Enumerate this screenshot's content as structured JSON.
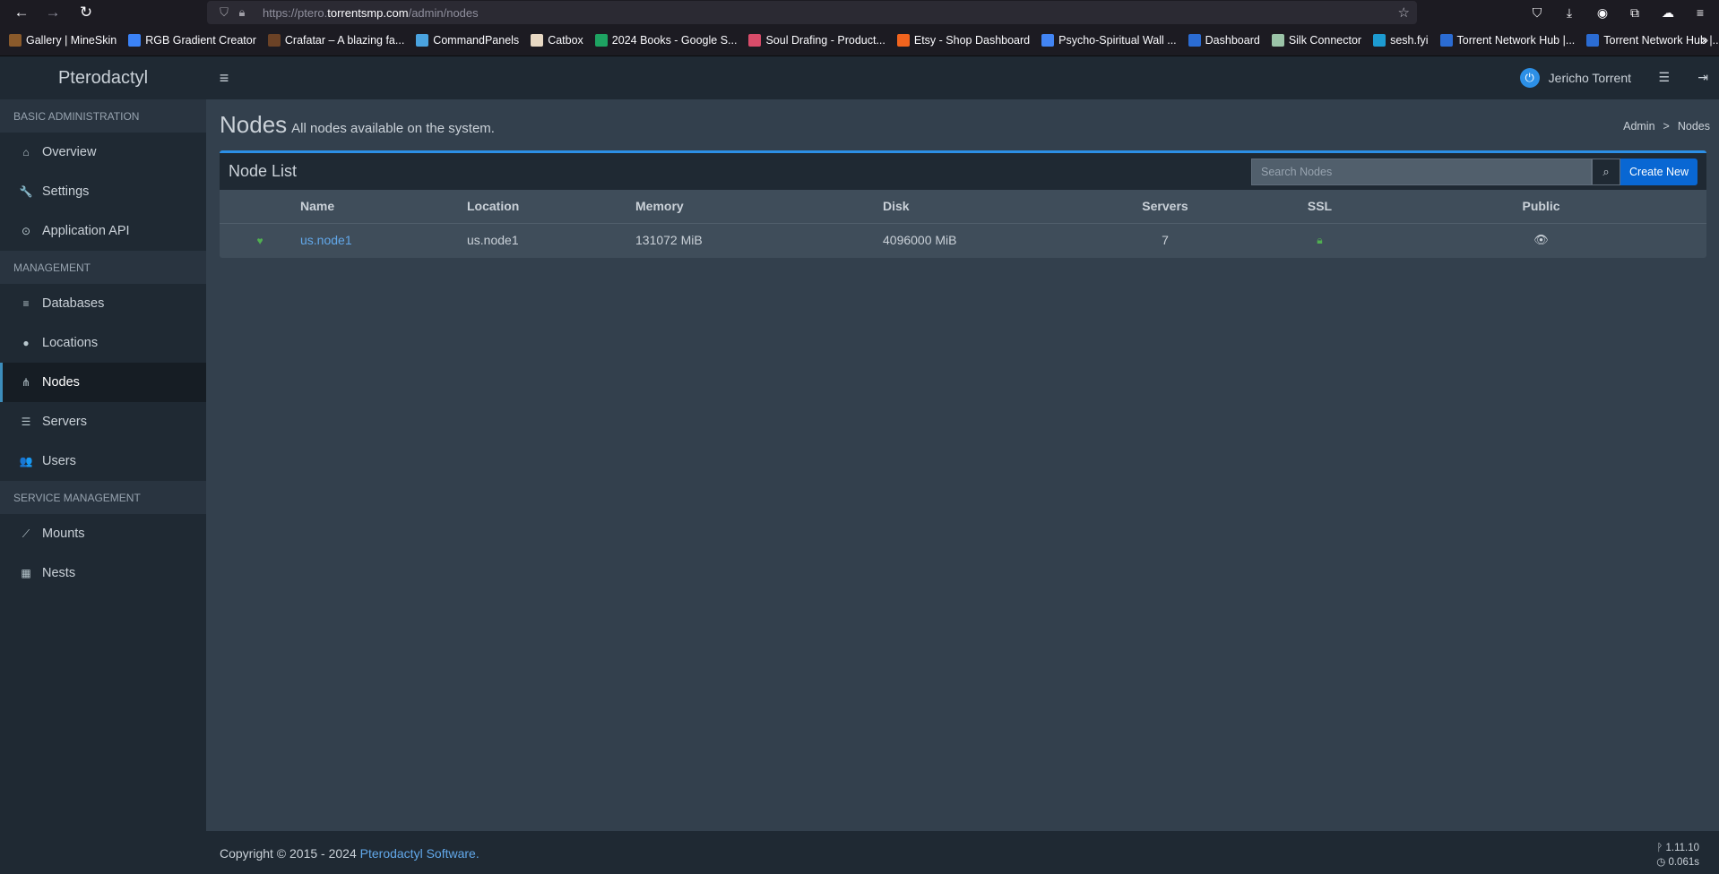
{
  "browser": {
    "url_prefix": "https://ptero.",
    "url_domain": "torrentsmp.com",
    "url_path": "/admin/nodes",
    "bookmarks": [
      {
        "label": "Gallery | MineSkin",
        "icon": "mineskin-icon",
        "color": "#8a5a2b"
      },
      {
        "label": "RGB Gradient Creator",
        "icon": "rgb-icon",
        "color": "#3b82f6"
      },
      {
        "label": "Crafatar – A blazing fa...",
        "icon": "crafatar-icon",
        "color": "#6b4226"
      },
      {
        "label": "CommandPanels",
        "icon": "commandpanels-icon",
        "color": "#4aa3df"
      },
      {
        "label": "Catbox",
        "icon": "catbox-icon",
        "color": "#e8d9c4"
      },
      {
        "label": "2024 Books - Google S...",
        "icon": "sheets-icon",
        "color": "#1ea362"
      },
      {
        "label": "Soul Drafing - Product...",
        "icon": "soul-icon",
        "color": "#d94c6a"
      },
      {
        "label": "Etsy - Shop Dashboard",
        "icon": "etsy-icon",
        "color": "#f1641e"
      },
      {
        "label": "Psycho-Spiritual Wall ...",
        "icon": "docs-icon",
        "color": "#4285f4"
      },
      {
        "label": "Dashboard",
        "icon": "dashboard-icon",
        "color": "#2b6cd3"
      },
      {
        "label": "Silk Connector",
        "icon": "silk-icon",
        "color": "#9bc4a8"
      },
      {
        "label": "sesh.fyi",
        "icon": "globe-icon",
        "color": "#1d9bd1"
      },
      {
        "label": "Torrent Network Hub |...",
        "icon": "torrent-icon",
        "color": "#2b6cd3"
      },
      {
        "label": "Torrent Network Hub |...",
        "icon": "torrent-icon",
        "color": "#2b6cd3"
      }
    ]
  },
  "header": {
    "brand": "Pterodactyl",
    "user_name": "Jericho Torrent"
  },
  "sidebar": {
    "sections": [
      {
        "title": "Basic Administration",
        "items": [
          {
            "label": "Overview",
            "icon": "home-icon",
            "glyph": "⌂"
          },
          {
            "label": "Settings",
            "icon": "wrench-icon",
            "glyph": "🔧"
          },
          {
            "label": "Application API",
            "icon": "gamepad-icon",
            "glyph": "⊙"
          }
        ]
      },
      {
        "title": "Management",
        "items": [
          {
            "label": "Databases",
            "icon": "database-icon",
            "glyph": "≡"
          },
          {
            "label": "Locations",
            "icon": "globe-icon",
            "glyph": "●"
          },
          {
            "label": "Nodes",
            "icon": "sitemap-icon",
            "glyph": "⋔",
            "active": true
          },
          {
            "label": "Servers",
            "icon": "server-icon",
            "glyph": "☰"
          },
          {
            "label": "Users",
            "icon": "users-icon",
            "glyph": "👥"
          }
        ]
      },
      {
        "title": "Service Management",
        "items": [
          {
            "label": "Mounts",
            "icon": "magic-icon",
            "glyph": "⟋"
          },
          {
            "label": "Nests",
            "icon": "th-large-icon",
            "glyph": "▦"
          }
        ]
      }
    ]
  },
  "page": {
    "title": "Nodes",
    "subtitle": "All nodes available on the system.",
    "breadcrumb": [
      "Admin",
      ">",
      "Nodes"
    ]
  },
  "node_list": {
    "title": "Node List",
    "search_placeholder": "Search Nodes",
    "create_label": "Create New",
    "columns": [
      "",
      "Name",
      "Location",
      "Memory",
      "Disk",
      "Servers",
      "SSL",
      "Public"
    ],
    "rows": [
      {
        "name": "us.node1",
        "location": "us.node1",
        "memory": "131072 MiB",
        "disk": "4096000 MiB",
        "servers": "7"
      }
    ]
  },
  "footer": {
    "copyright": "Copyright © 2015 - 2024 ",
    "link": "Pterodactyl Software.",
    "version": "1.11.10",
    "time": "0.061s"
  }
}
